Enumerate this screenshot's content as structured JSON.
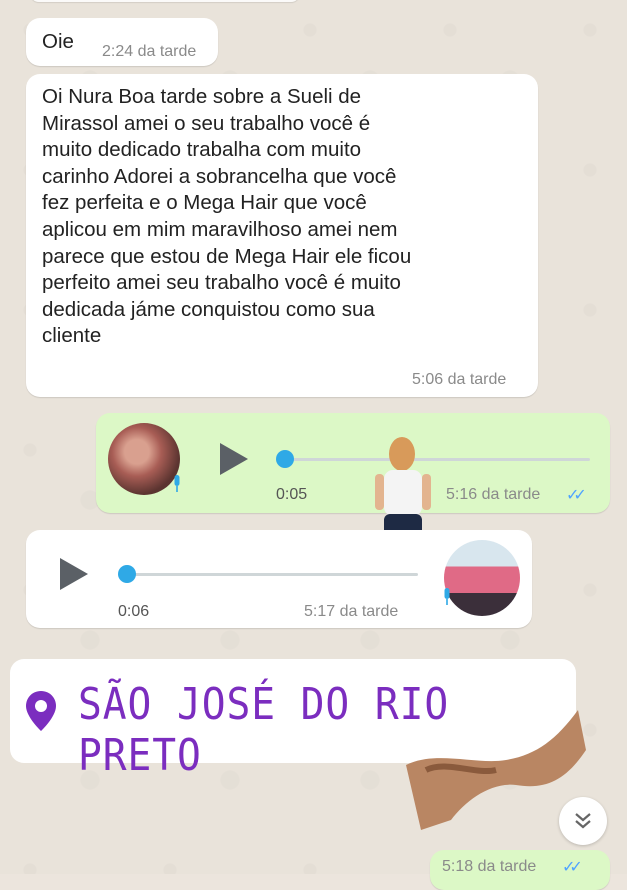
{
  "messages": [
    {
      "text": "Oie",
      "time": "2:24 da tarde"
    },
    {
      "text_lines": [
        "Oi Nura Boa tarde sobre a Sueli de",
        "Mirassol amei o seu trabalho você é",
        "muito dedicado trabalha com muito",
        "carinho Adorei a sobrancelha que você",
        "fez perfeita e o Mega Hair que você",
        "aplicou em mim maravilhoso amei nem",
        "parece que estou de Mega Hair ele ficou",
        "perfeito amei seu trabalho você é muito",
        "dedicada jáme conquistou  como sua",
        "cliente"
      ],
      "time": "5:06 da tarde"
    }
  ],
  "voice_out": {
    "duration": "0:05",
    "time": "5:16 da tarde",
    "progress": 0,
    "ticks": "✓✓"
  },
  "voice_in": {
    "duration": "0:06",
    "time": "5:17 da tarde",
    "progress": 0
  },
  "location": {
    "label": "SÃO JOSÉ DO RIO PRETO",
    "color": "#7b2dbf"
  },
  "bottom_msg": {
    "time": "5:18 da tarde",
    "ticks": "✓✓"
  },
  "colors": {
    "out_bubble": "#dcf8c6",
    "in_bubble": "#ffffff",
    "accent": "#2fa9e6",
    "read_ticks": "#4fa3ff"
  },
  "icons": [
    "play-icon",
    "mic-icon",
    "chevron-down-icon",
    "location-pin-icon",
    "double-check-icon"
  ]
}
